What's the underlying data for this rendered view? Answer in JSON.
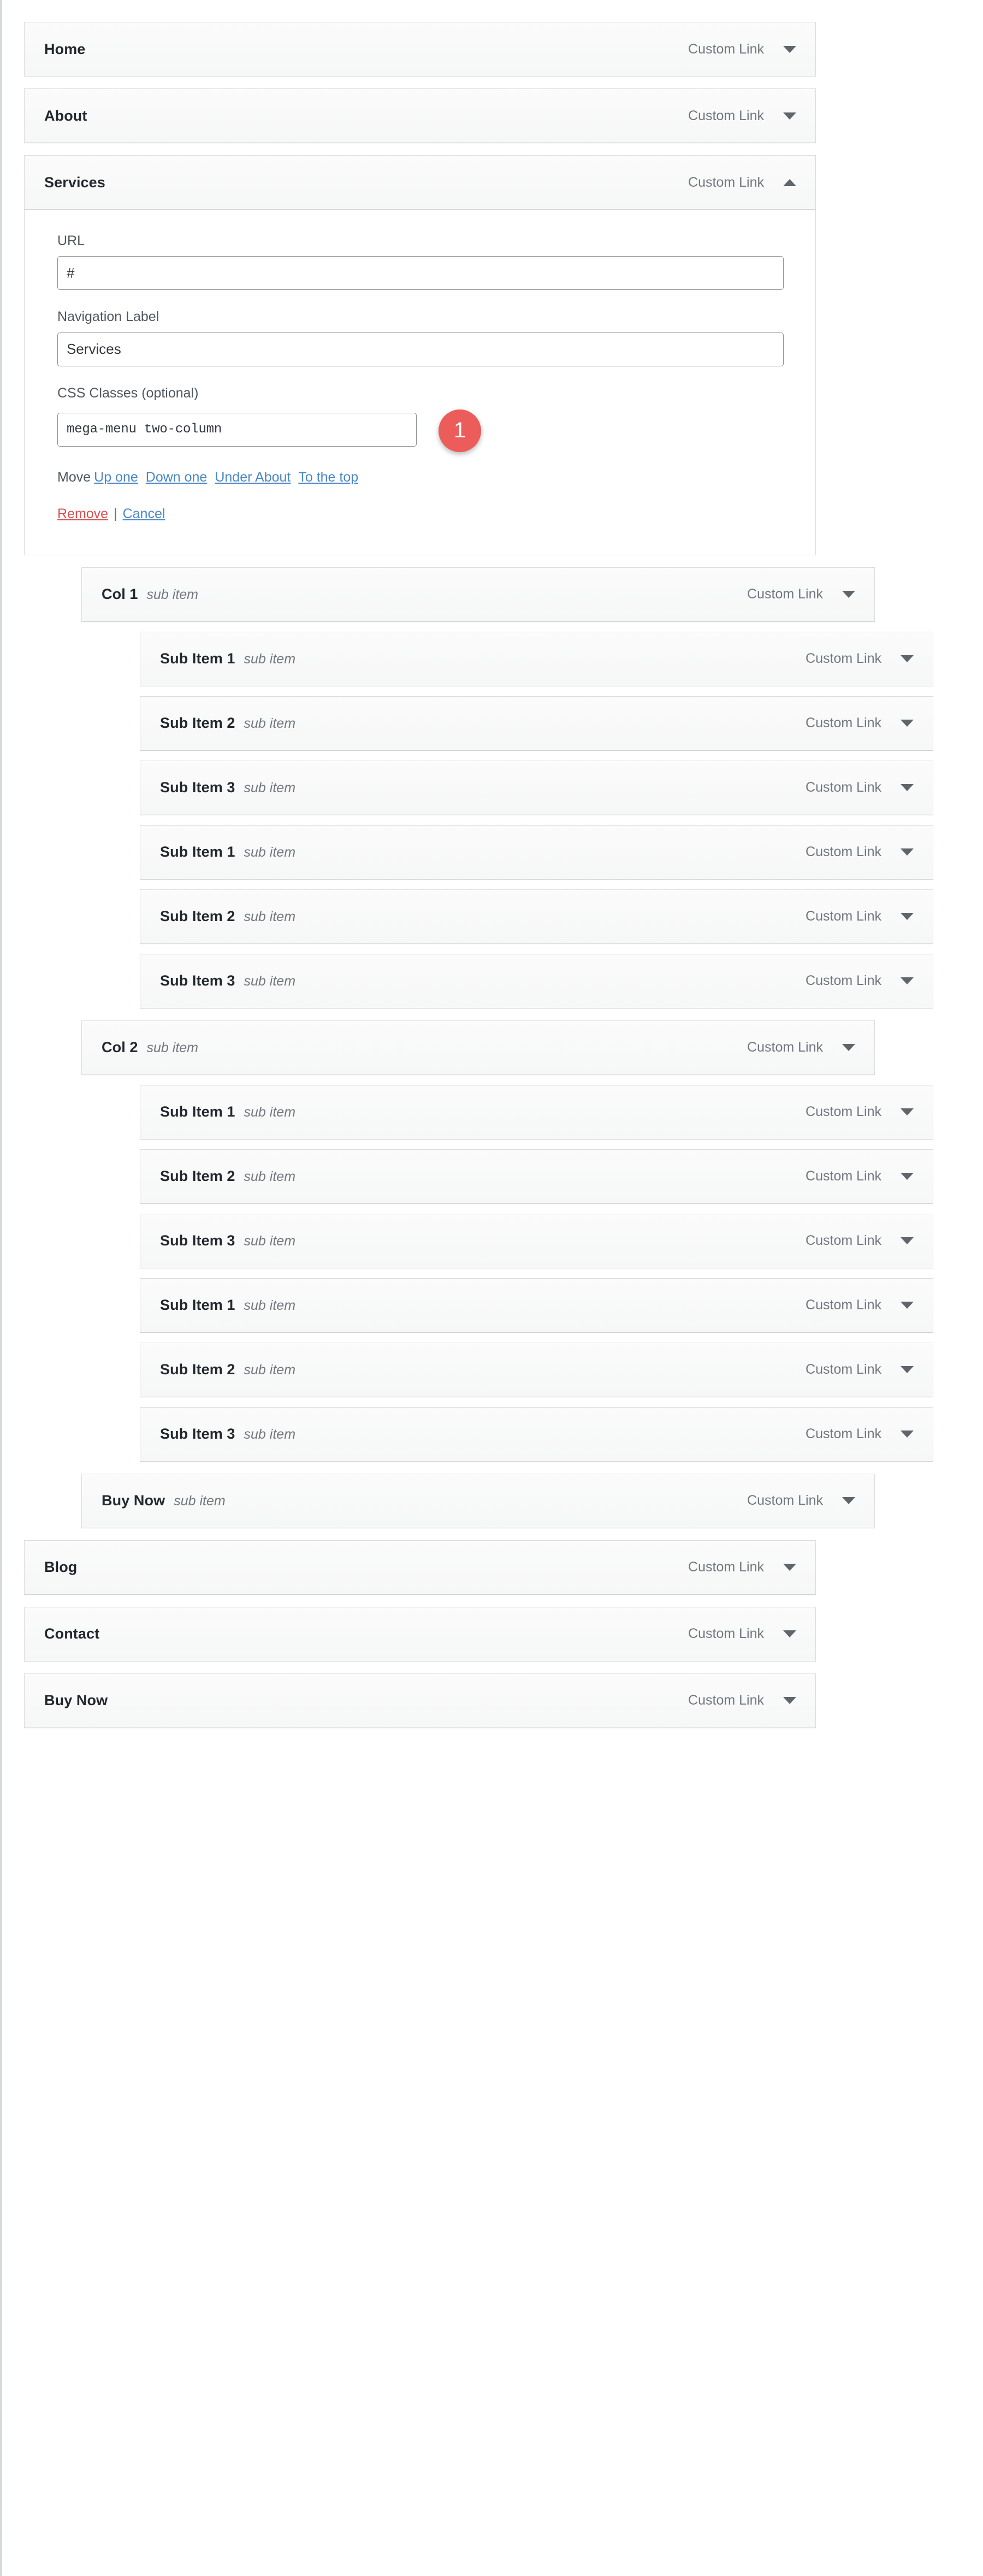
{
  "editor": {
    "type_label": "Custom Link",
    "caret_down_icon": "chevron-down-icon",
    "caret_up_icon": "chevron-up-icon"
  },
  "menu_items": [
    {
      "label": "Home",
      "sub_label": "",
      "type": "Custom Link",
      "depth": 0,
      "expanded": false
    },
    {
      "label": "About",
      "sub_label": "",
      "type": "Custom Link",
      "depth": 0,
      "expanded": false
    },
    {
      "label": "Services",
      "sub_label": "",
      "type": "Custom Link",
      "depth": 0,
      "expanded": true
    },
    {
      "label": "Col 1",
      "sub_label": "sub item",
      "type": "Custom Link",
      "depth": 1,
      "expanded": false
    },
    {
      "label": "Sub Item 1",
      "sub_label": "sub item",
      "type": "Custom Link",
      "depth": 2,
      "expanded": false
    },
    {
      "label": "Sub Item 2",
      "sub_label": "sub item",
      "type": "Custom Link",
      "depth": 2,
      "expanded": false
    },
    {
      "label": "Sub Item 3",
      "sub_label": "sub item",
      "type": "Custom Link",
      "depth": 2,
      "expanded": false
    },
    {
      "label": "Sub Item 1",
      "sub_label": "sub item",
      "type": "Custom Link",
      "depth": 2,
      "expanded": false
    },
    {
      "label": "Sub Item 2",
      "sub_label": "sub item",
      "type": "Custom Link",
      "depth": 2,
      "expanded": false
    },
    {
      "label": "Sub Item 3",
      "sub_label": "sub item",
      "type": "Custom Link",
      "depth": 2,
      "expanded": false
    },
    {
      "label": "Col 2",
      "sub_label": "sub item",
      "type": "Custom Link",
      "depth": 1,
      "expanded": false
    },
    {
      "label": "Sub Item 1",
      "sub_label": "sub item",
      "type": "Custom Link",
      "depth": 2,
      "expanded": false
    },
    {
      "label": "Sub Item 2",
      "sub_label": "sub item",
      "type": "Custom Link",
      "depth": 2,
      "expanded": false
    },
    {
      "label": "Sub Item 3",
      "sub_label": "sub item",
      "type": "Custom Link",
      "depth": 2,
      "expanded": false
    },
    {
      "label": "Sub Item 1",
      "sub_label": "sub item",
      "type": "Custom Link",
      "depth": 2,
      "expanded": false
    },
    {
      "label": "Sub Item 2",
      "sub_label": "sub item",
      "type": "Custom Link",
      "depth": 2,
      "expanded": false
    },
    {
      "label": "Sub Item 3",
      "sub_label": "sub item",
      "type": "Custom Link",
      "depth": 2,
      "expanded": false
    },
    {
      "label": "Buy Now",
      "sub_label": "sub item",
      "type": "Custom Link",
      "depth": 1,
      "expanded": false
    },
    {
      "label": "Blog",
      "sub_label": "",
      "type": "Custom Link",
      "depth": 0,
      "expanded": false
    },
    {
      "label": "Contact",
      "sub_label": "",
      "type": "Custom Link",
      "depth": 0,
      "expanded": false
    },
    {
      "label": "Buy Now",
      "sub_label": "",
      "type": "Custom Link",
      "depth": 0,
      "expanded": false
    }
  ],
  "edit_panel": {
    "url": {
      "label": "URL",
      "value": "#",
      "placeholder": ""
    },
    "nav_label": {
      "label": "Navigation Label",
      "value": "Services",
      "placeholder": ""
    },
    "css_classes": {
      "label": "CSS Classes (optional)",
      "value": "mega-menu two-column",
      "placeholder": ""
    },
    "step_badge": "1",
    "move": {
      "word": "Move",
      "links": [
        "Up one",
        "Down one",
        "Under About",
        "To the top"
      ]
    },
    "actions": {
      "remove": "Remove",
      "separator": "|",
      "cancel": "Cancel"
    }
  },
  "colors": {
    "badge_red": "#ec5c5a",
    "link_blue": "#4a87c4",
    "link_red": "#d94f4f",
    "row_bg": "#f6f7f7",
    "row_border": "#dcdcde",
    "text_dark": "#23282d",
    "text_muted": "#72777c"
  }
}
